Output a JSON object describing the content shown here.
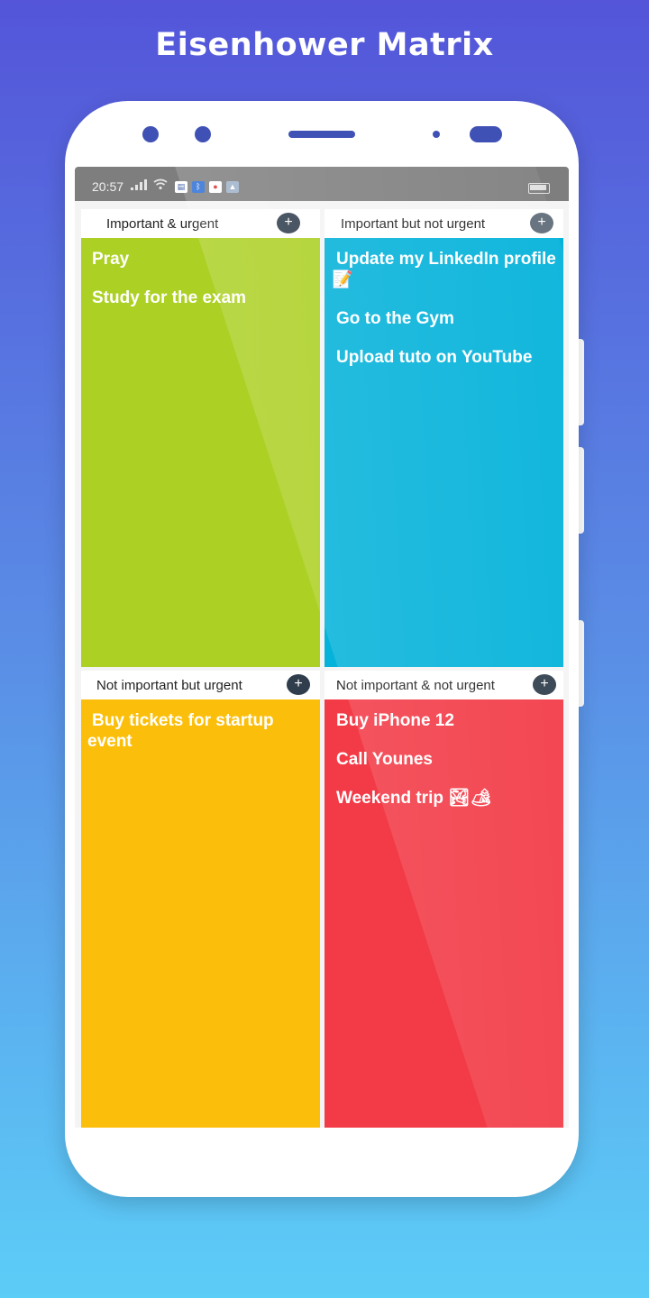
{
  "headline": "Eisenhower Matrix",
  "status_bar": {
    "time": "20:57"
  },
  "quadrants": [
    {
      "label": "Important & urgent",
      "add_symbol": "+",
      "color": "#acd024",
      "tasks": [
        "Pray",
        "Study for the exam"
      ]
    },
    {
      "label": "Important but not urgent",
      "add_symbol": "+",
      "color": "#04b2da",
      "tasks": [
        "Update my LinkedIn profile 📝",
        "Go to the Gym",
        "Upload tuto on YouTube"
      ]
    },
    {
      "label": "Not important but urgent",
      "add_symbol": "+",
      "color": "#fbbf0b",
      "tasks": [
        "Buy tickets for startup event"
      ]
    },
    {
      "label": "Not important & not urgent",
      "add_symbol": "+",
      "color": "#f23b47",
      "tasks": [
        "Buy iPhone 12",
        "Call Younes",
        "Weekend trip 🏞🏕"
      ]
    }
  ],
  "colors": {
    "accent": "#3f51b5",
    "add_button": "#2f3d4c"
  }
}
